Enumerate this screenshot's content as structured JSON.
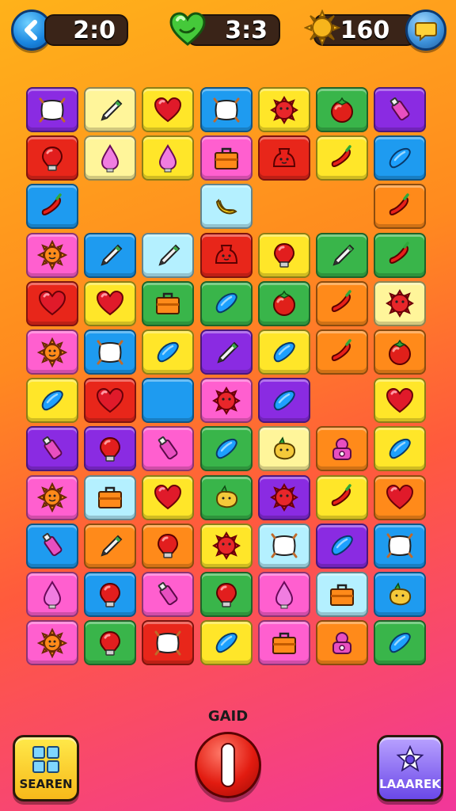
{
  "hud": {
    "timer": "2:0",
    "lives": "3:3",
    "coins": "160"
  },
  "colors": {
    "purple": "#8a2be2",
    "yellow": "#ffe629",
    "paleyellow": "#fff59a",
    "blue": "#1e9bf0",
    "red": "#e8261a",
    "green": "#39b54a",
    "orange": "#ff8a1a",
    "pink": "#ff5fcf",
    "cyan": "#b4f0ff"
  },
  "board": {
    "rows": [
      [
        [
          "purple",
          "pillow"
        ],
        [
          "paleyellow",
          "pen"
        ],
        [
          "yellow",
          "heart"
        ],
        [
          "blue",
          "pillow"
        ],
        [
          "yellow",
          "gear"
        ],
        [
          "green",
          "tomato"
        ],
        [
          "purple",
          "tube"
        ]
      ],
      [
        [
          "red",
          "bulb"
        ],
        [
          "paleyellow",
          "drop"
        ],
        [
          "yellow",
          "drop"
        ],
        [
          "pink",
          "case"
        ],
        [
          "red",
          "bag"
        ],
        [
          "yellow",
          "chili"
        ],
        [
          "blue",
          "bean"
        ]
      ],
      [
        [
          "blue",
          "chili"
        ],
        null,
        null,
        [
          "cyan",
          "banana"
        ],
        null,
        null,
        [
          "orange",
          "chili"
        ]
      ],
      [
        [
          "pink",
          "sun"
        ],
        [
          "blue",
          "pen"
        ],
        [
          "cyan",
          "pen"
        ],
        [
          "red",
          "bag"
        ],
        [
          "yellow",
          "bulb"
        ],
        [
          "green",
          "pen"
        ],
        [
          "green",
          "chili"
        ]
      ],
      [
        [
          "red",
          "heart"
        ],
        [
          "yellow",
          "heart"
        ],
        [
          "green",
          "case"
        ],
        [
          "green",
          "bean"
        ],
        [
          "green",
          "tomato"
        ],
        [
          "orange",
          "chili"
        ],
        [
          "paleyellow",
          "gear"
        ]
      ],
      [
        [
          "pink",
          "sun"
        ],
        [
          "blue",
          "pillow"
        ],
        [
          "yellow",
          "bean"
        ],
        [
          "purple",
          "pen"
        ],
        [
          "yellow",
          "bean"
        ],
        [
          "orange",
          "chili"
        ],
        [
          "orange",
          "tomato"
        ]
      ],
      [
        [
          "yellow",
          "bean"
        ],
        [
          "red",
          "heart"
        ],
        [
          "blue",
          "empty"
        ],
        [
          "pink",
          "gear"
        ],
        [
          "purple",
          "bean"
        ],
        null,
        [
          "yellow",
          "heart"
        ]
      ],
      [
        [
          "purple",
          "tube"
        ],
        [
          "purple",
          "bulb"
        ],
        [
          "pink",
          "tube"
        ],
        [
          "green",
          "bean"
        ],
        [
          "paleyellow",
          "potato"
        ],
        [
          "orange",
          "cake"
        ],
        [
          "yellow",
          "bean"
        ]
      ],
      [
        [
          "pink",
          "sun"
        ],
        [
          "cyan",
          "case"
        ],
        [
          "yellow",
          "heart"
        ],
        [
          "green",
          "potato"
        ],
        [
          "purple",
          "gear"
        ],
        [
          "yellow",
          "chili"
        ],
        [
          "orange",
          "heart"
        ]
      ],
      [
        [
          "blue",
          "tube"
        ],
        [
          "orange",
          "pen"
        ],
        [
          "orange",
          "bulb"
        ],
        [
          "yellow",
          "gear"
        ],
        [
          "cyan",
          "pillow"
        ],
        [
          "purple",
          "bean"
        ],
        [
          "blue",
          "pillow"
        ]
      ],
      [
        [
          "pink",
          "drop"
        ],
        [
          "blue",
          "bulb"
        ],
        [
          "pink",
          "tube"
        ],
        [
          "green",
          "bulb"
        ],
        [
          "pink",
          "drop"
        ],
        [
          "cyan",
          "case"
        ],
        [
          "blue",
          "potato"
        ]
      ],
      [
        [
          "pink",
          "sun"
        ],
        [
          "green",
          "bulb"
        ],
        [
          "red",
          "pillow"
        ],
        [
          "yellow",
          "bean"
        ],
        [
          "pink",
          "case"
        ],
        [
          "orange",
          "cake"
        ],
        [
          "green",
          "bean"
        ]
      ]
    ]
  },
  "bottom": {
    "grid_label": "GAID",
    "left_button": "SEAREN",
    "right_button": "LAAAREK"
  }
}
